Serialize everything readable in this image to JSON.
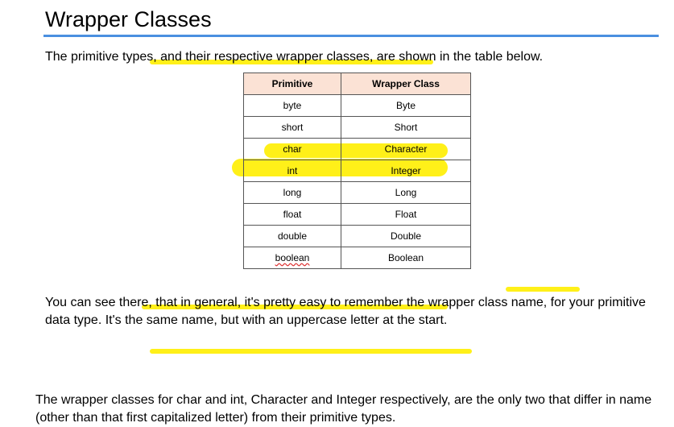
{
  "slide": {
    "title": "Wrapper Classes",
    "intro": "The primitive types, and their respective wrapper classes, are shown in the table below.",
    "paragraph2": "You can see there, that in general, it's pretty easy to remember the wrapper class name, for your primitive data type. It's the same name, but with an uppercase letter at the start.",
    "paragraph3": "The wrapper classes for char and int, Character and Integer respectively, are the only two that differ in name (other than that first capitalized letter) from their primitive types."
  },
  "table": {
    "headers": [
      "Primitive",
      "Wrapper Class"
    ],
    "rows": [
      [
        "byte",
        "Byte"
      ],
      [
        "short",
        "Short"
      ],
      [
        "char",
        "Character"
      ],
      [
        "int",
        "Integer"
      ],
      [
        "long",
        "Long"
      ],
      [
        "float",
        "Float"
      ],
      [
        "double",
        "Double"
      ],
      [
        "boolean",
        "Boolean"
      ]
    ]
  },
  "colors": {
    "title_rule": "#4a8fe0",
    "highlighter": "#ffee00",
    "header_fill": "#fbe2d5"
  }
}
